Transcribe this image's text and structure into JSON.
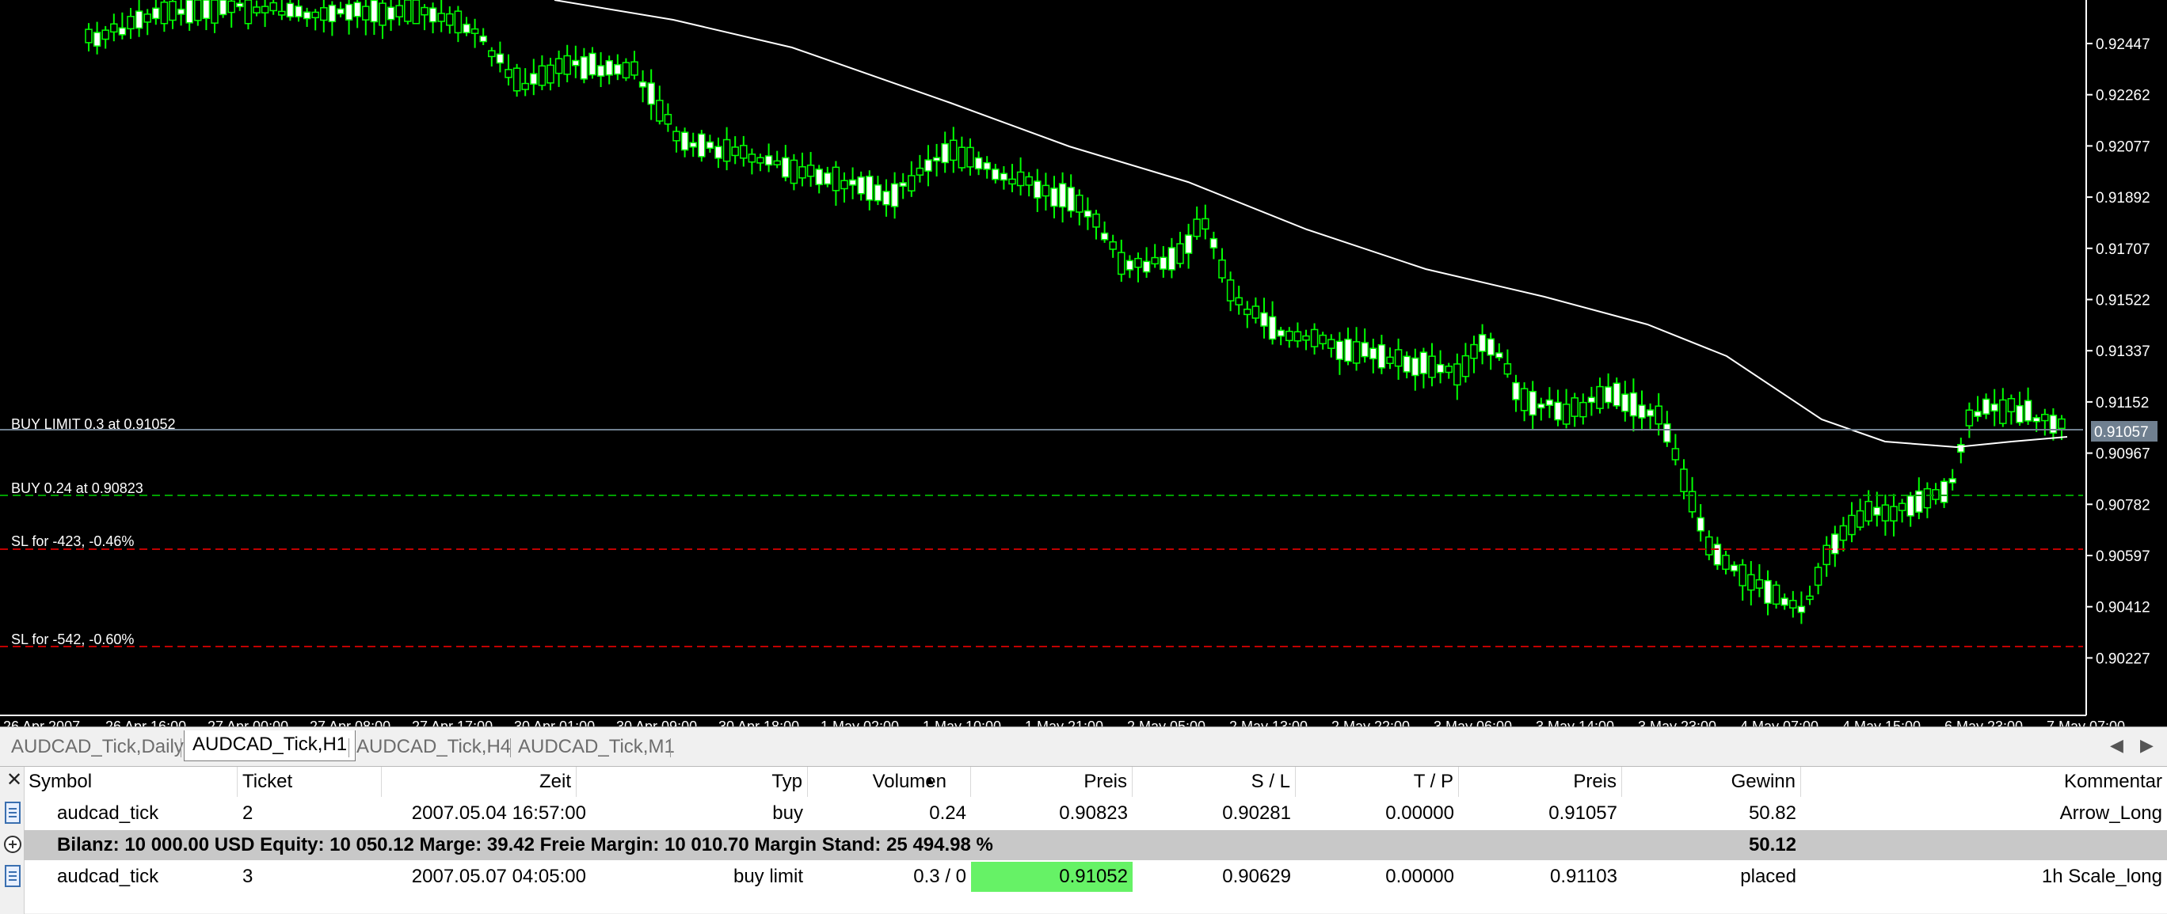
{
  "chart": {
    "price_axis": [
      "0.92447",
      "0.92262",
      "0.92077",
      "0.91892",
      "0.91707",
      "0.91522",
      "0.91337",
      "0.91152",
      "0.90967",
      "0.90782",
      "0.90597",
      "0.90412",
      "0.90227"
    ],
    "current_price": "0.91057",
    "time_axis": [
      "26 Apr 2007",
      "26 Apr 16:00",
      "27 Apr 00:00",
      "27 Apr 08:00",
      "27 Apr 17:00",
      "30 Apr 01:00",
      "30 Apr 09:00",
      "30 Apr 18:00",
      "1 May 02:00",
      "1 May 10:00",
      "1 May 21:00",
      "2 May 05:00",
      "2 May 13:00",
      "2 May 22:00",
      "3 May 06:00",
      "3 May 14:00",
      "3 May 23:00",
      "4 May 07:00",
      "4 May 15:00",
      "6 May 23:00",
      "7 May 07:00"
    ],
    "line_labels": {
      "buy_limit": "BUY LIMIT 0.3 at 0.91052",
      "buy": "BUY 0.24 at 0.90823",
      "sl1": "SL for -423, -0.46%",
      "sl2": "SL for -542, -0.60%"
    },
    "colors": {
      "candle_up": "#00ff00",
      "candle_body": "#ffffff",
      "ma": "#ffffff",
      "buy_line": "#00a000",
      "sl_line": "#c00000",
      "limit_line": "#708090"
    }
  },
  "tabs": [
    "AUDCAD_Tick,Daily",
    "AUDCAD_Tick,H1",
    "AUDCAD_Tick,H4",
    "AUDCAD_Tick,M1"
  ],
  "active_tab": "AUDCAD_Tick,H1",
  "terminal": {
    "headers": [
      "Symbol",
      "Ticket",
      "Zeit",
      "Typ",
      "Volumen",
      "Preis",
      "S / L",
      "T / P",
      "Preis",
      "Gewinn",
      "Kommentar"
    ],
    "rows": [
      [
        "audcad_tick",
        "2",
        "2007.05.04 16:57:00",
        "buy",
        "0.24",
        "0.90823",
        "0.90281",
        "0.00000",
        "0.91057",
        "50.82",
        "Arrow_Long"
      ],
      [
        "audcad_tick",
        "3",
        "2007.05.07 04:05:00",
        "buy limit",
        "0.3 / 0",
        "0.91052",
        "0.90629",
        "0.00000",
        "0.91103",
        "placed",
        "1h Scale_long"
      ]
    ],
    "summary": {
      "text": "Bilanz: 10 000.00 USD  Equity: 10 050.12  Marge: 39.42  Freie Margin: 10 010.70  Margin Stand: 25 494.98 %",
      "profit": "50.12"
    }
  }
}
